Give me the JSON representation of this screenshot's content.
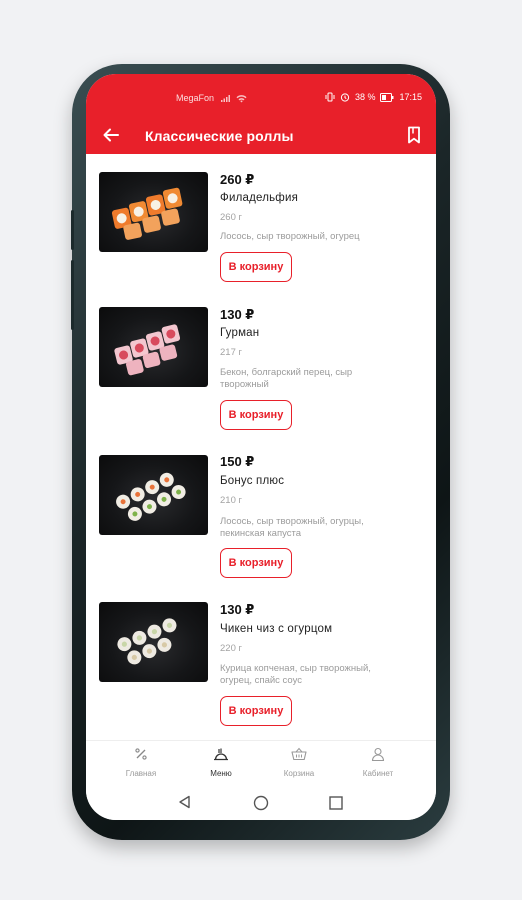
{
  "status_bar": {
    "carrier": "MegaFon",
    "battery": "38 %",
    "time": "17:15"
  },
  "app_bar": {
    "title": "Классические роллы"
  },
  "products": [
    {
      "price": "260 ₽",
      "name": "Филадельфия",
      "weight": "260 г",
      "description": "Лосось, сыр творожный, огурец",
      "button": "В корзину"
    },
    {
      "price": "130 ₽",
      "name": "Гурман",
      "weight": "217 г",
      "description": "Бекон, болгарский перец, сыр творожный",
      "button": "В корзину"
    },
    {
      "price": "150 ₽",
      "name": "Бонус плюс",
      "weight": "210 г",
      "description": "Лосось, сыр творожный, огурцы, пекинская капуста",
      "button": "В корзину"
    },
    {
      "price": "130 ₽",
      "name": "Чикен чиз с огурцом",
      "weight": "220 г",
      "description": "Курица копченая, сыр творожный, огурец, спайс соус",
      "button": "В корзину"
    }
  ],
  "bottom_nav": [
    {
      "label": "Главная",
      "icon": "percent-icon"
    },
    {
      "label": "Меню",
      "icon": "menu-food-icon",
      "active": true
    },
    {
      "label": "Корзина",
      "icon": "basket-icon"
    },
    {
      "label": "Кабинет",
      "icon": "user-icon"
    }
  ],
  "colors": {
    "accent": "#e8202a",
    "text_secondary": "#9b9b9b"
  }
}
